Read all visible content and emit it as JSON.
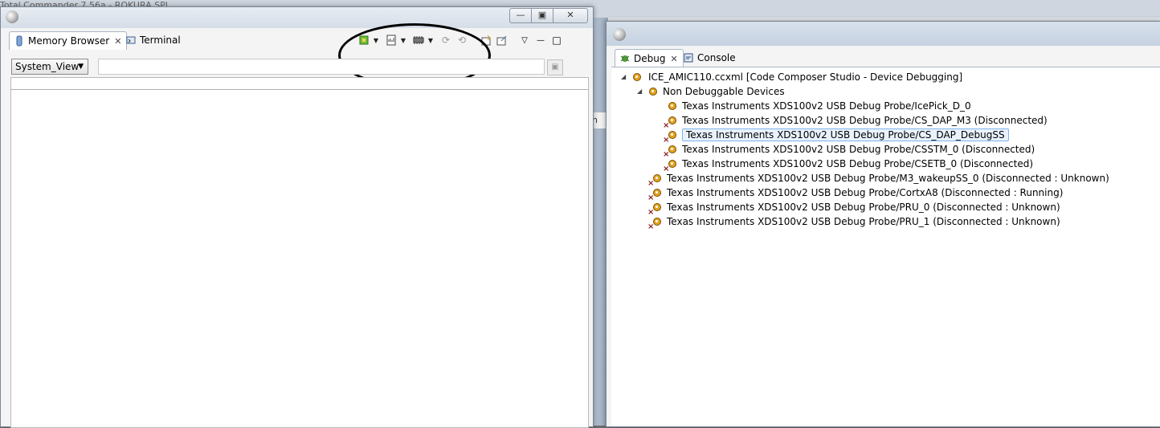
{
  "background": {
    "title": "Total Commander 7.56a - ROKURA SPL"
  },
  "left_window": {
    "tabs": [
      {
        "label": "Memory Browser",
        "active": true,
        "closable": true,
        "icon": "memory-icon"
      },
      {
        "label": "Terminal",
        "active": false,
        "closable": false,
        "icon": "terminal-icon"
      }
    ],
    "view_select": "System_View",
    "address_input": "",
    "toolbar_icons": [
      "new-memory-monitor-icon",
      "memory-format-icon",
      "memory-chip-icon",
      "refresh-icon",
      "continuous-refresh-icon",
      "import-icon",
      "export-icon",
      "view-menu-icon",
      "minimize-icon",
      "maximize-icon"
    ]
  },
  "right_window": {
    "tabs": [
      {
        "label": "Debug",
        "active": true,
        "closable": true,
        "icon": "debug-icon"
      },
      {
        "label": "Console",
        "active": false,
        "closable": false,
        "icon": "console-icon"
      }
    ],
    "tree": [
      {
        "label": "ICE_AMIC110.ccxml [Code Composer Studio - Device Debugging]",
        "level": 0,
        "expanded": true,
        "icon": "launch-icon"
      },
      {
        "label": "Non Debuggable Devices",
        "level": 1,
        "expanded": true,
        "icon": "device-group-icon"
      },
      {
        "label": "Texas Instruments XDS100v2 USB Debug Probe/IcePick_D_0",
        "level": 2,
        "disconnected_marker": false
      },
      {
        "label": "Texas Instruments XDS100v2 USB Debug Probe/CS_DAP_M3  (Disconnected)",
        "level": 2,
        "disconnected_marker": true
      },
      {
        "label": "Texas Instruments XDS100v2 USB Debug Probe/CS_DAP_DebugSS",
        "level": 2,
        "disconnected_marker": true,
        "selected": true
      },
      {
        "label": "Texas Instruments XDS100v2 USB Debug Probe/CSSTM_0  (Disconnected)",
        "level": 2,
        "disconnected_marker": true
      },
      {
        "label": "Texas Instruments XDS100v2 USB Debug Probe/CSETB_0  (Disconnected)",
        "level": 2,
        "disconnected_marker": true
      },
      {
        "label": "Texas Instruments XDS100v2 USB Debug Probe/M3_wakeupSS_0 (Disconnected : Unknown)",
        "level": 1,
        "disconnected_marker": true
      },
      {
        "label": "Texas Instruments XDS100v2 USB Debug Probe/CortxA8 (Disconnected : Running)",
        "level": 1,
        "disconnected_marker": true
      },
      {
        "label": "Texas Instruments XDS100v2 USB Debug Probe/PRU_0 (Disconnected : Unknown)",
        "level": 1,
        "disconnected_marker": true
      },
      {
        "label": "Texas Instruments XDS100v2 USB Debug Probe/PRU_1 (Disconnected : Unknown)",
        "level": 1,
        "disconnected_marker": true
      }
    ]
  },
  "colors": {
    "selection_bg": "#e8f2fd",
    "selection_border": "#7fb2ea",
    "gear": "#e6a21e",
    "annotation_oval": "#000000"
  }
}
